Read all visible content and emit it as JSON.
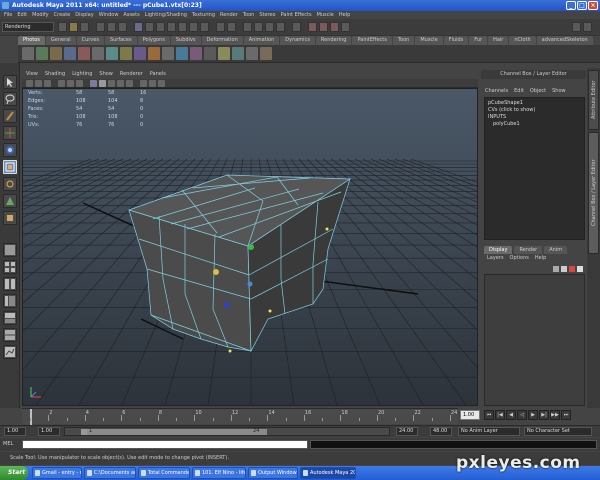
{
  "window": {
    "title": "Autodesk Maya 2011 x64: untitled*   ---   pCube1.vtx[0:23]"
  },
  "menubar": {
    "items": [
      "File",
      "Edit",
      "Modify",
      "Create",
      "Display",
      "Window",
      "Assets",
      "Lighting/Shading",
      "Texturing",
      "Render",
      "Toon",
      "Stereo",
      "Paint Effects",
      "Muscle",
      "Help"
    ]
  },
  "statusline": {
    "mode": "Rendering"
  },
  "shelf": {
    "tabs": [
      "Photos",
      "General",
      "Curves",
      "Surfaces",
      "Polygons",
      "Subdivs",
      "Deformation",
      "Animation",
      "Dynamics",
      "Rendering",
      "PaintEffects",
      "Toon",
      "Muscle",
      "Fluids",
      "Fur",
      "Hair",
      "nCloth",
      "advancedSkeleton"
    ],
    "active_tab": "Photos"
  },
  "panel": {
    "menu": [
      "View",
      "Shading",
      "Lighting",
      "Show",
      "Renderer",
      "Panels"
    ]
  },
  "hud": {
    "rows": [
      {
        "label": "Verts:",
        "a": "58",
        "b": "58",
        "c": "16"
      },
      {
        "label": "Edges:",
        "a": "108",
        "b": "104",
        "c": "8"
      },
      {
        "label": "Faces:",
        "a": "54",
        "b": "54",
        "c": "0"
      },
      {
        "label": "Tris:",
        "a": "108",
        "b": "108",
        "c": "0"
      },
      {
        "label": "UVs:",
        "a": "76",
        "b": "76",
        "c": "0"
      }
    ]
  },
  "channelbox": {
    "header": "Channel Box / Layer Editor",
    "menu": [
      "Channels",
      "Edit",
      "Object",
      "Show"
    ],
    "lines": [
      "pCubeShape1",
      "CVs (click to show)",
      "INPUTS",
      "polyCube1"
    ]
  },
  "layers": {
    "tabs": [
      "Display",
      "Render",
      "Anim"
    ],
    "menu": [
      "Layers",
      "Options",
      "Help"
    ]
  },
  "sidetabs": [
    "Attribute Editor",
    "Channel Box / Layer Editor"
  ],
  "timeslider": {
    "ticks": [
      "2",
      "4",
      "6",
      "8",
      "10",
      "12",
      "14",
      "16",
      "18",
      "20",
      "22",
      "24"
    ],
    "current_frame": "1.00"
  },
  "range": {
    "start": "1.00",
    "start2": "1.00",
    "slider_val": "1",
    "slider_end": "24",
    "end": "24.00",
    "end2": "48.00",
    "anim_layer": "No Anim Layer",
    "character_set": "No Character Set"
  },
  "mel": {
    "label": "MEL"
  },
  "helpline": {
    "text": "Scale Tool: Use manipulator to scale object(s). Use edit mode to change pivot (INSERT)."
  },
  "taskbar": {
    "start": "Start",
    "tasks": [
      "Gmail - entry - mnrose...",
      "C:\\Documents and Set...",
      "Total Commander 6.03...",
      "101. Elf Nino - lifeless M...",
      "Output Window",
      "Autodesk Maya 2011..."
    ],
    "active_task": "Autodesk Maya 2011..."
  },
  "watermark": {
    "text": "pxleyes.com"
  },
  "colors": {
    "wire": "#8fd8e8",
    "mesh_face": "#4a4a4a",
    "grid": "#1e2226",
    "title_bar": "#2a5bd0",
    "taskbar": "#2f64d8"
  }
}
